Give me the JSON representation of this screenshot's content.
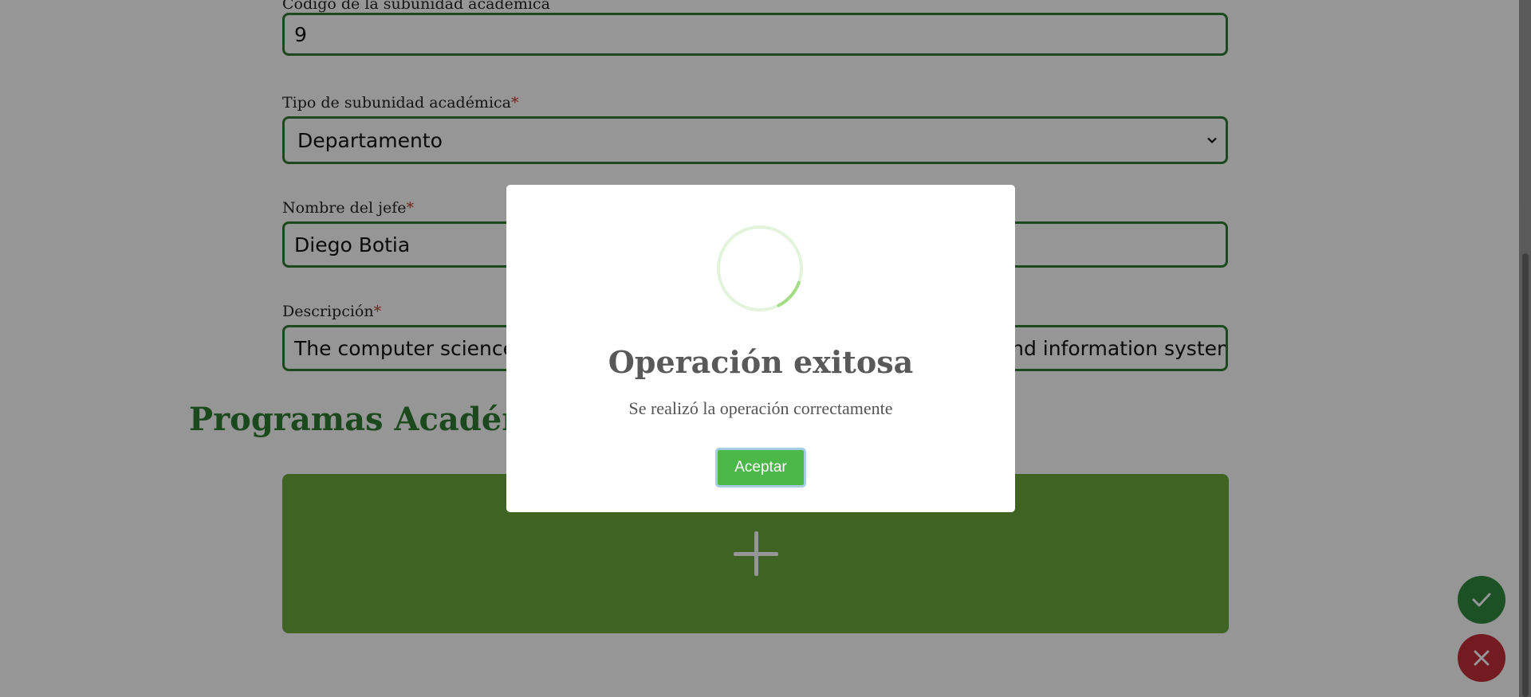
{
  "form": {
    "code_label": "Código de la subunidad académica",
    "code_value": "9",
    "type_label": "Tipo de subunidad académica",
    "type_required": "*",
    "type_value": "Departamento",
    "head_label": "Nombre del jefe",
    "head_required": "*",
    "head_value": "Diego Botia",
    "description_label": "Descripción",
    "description_required": "*",
    "description_value": "The computer science department advances knowledge in computing and information systems through research and teaching"
  },
  "programs": {
    "section_title": "Programas Académicos"
  },
  "modal": {
    "title": "Operación exitosa",
    "message": "Se realizó la operación correctamente",
    "accept_label": "Aceptar",
    "spinner_progress": 0.12
  },
  "actions": {
    "confirm_icon": "check-icon",
    "cancel_icon": "close-icon"
  },
  "colors": {
    "primary_green": "#2e7d32",
    "card_green": "#6aa83a",
    "accept_green": "#4cb849",
    "cancel_red": "#c62f38",
    "required_red": "#c0392b"
  }
}
